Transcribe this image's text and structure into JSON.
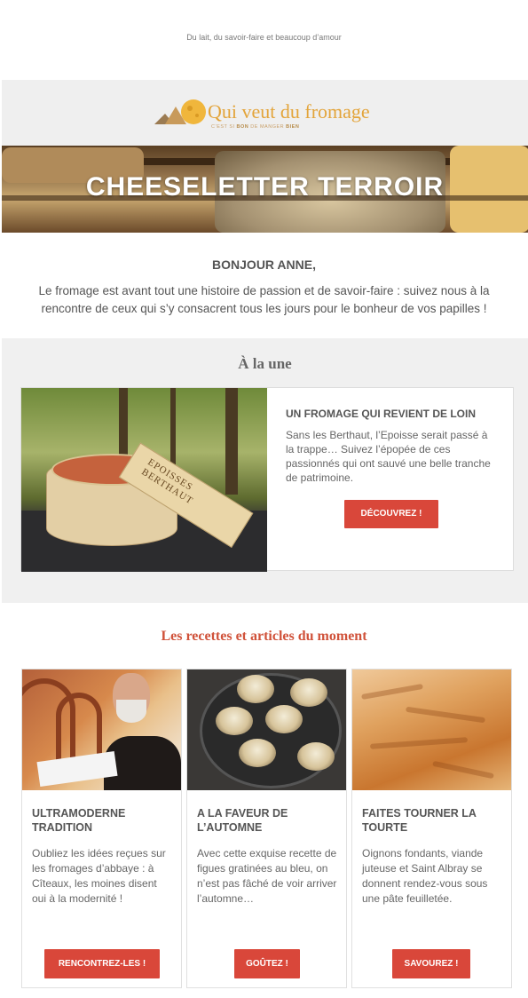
{
  "preheader": "Du lait, du savoir-faire et beaucoup d’amour",
  "logo": {
    "title": "Qui veut du fromage",
    "tagline_1": "C’EST SI ",
    "tagline_2": "BON",
    "tagline_3": " DE MANGER ",
    "tagline_4": "BIEN"
  },
  "hero": {
    "title": "CHEESELETTER TERROIR"
  },
  "greeting": "BONJOUR ANNE,",
  "intro": "Le fromage est avant tout une histoire de passion et de savoir-faire : suivez nous à la rencontre de ceux qui s’y consacrent tous les jours pour le bonheur de vos papilles !",
  "une": {
    "section_title": "À la une",
    "box_text_1": "EPOISSES",
    "box_text_2": "BERTHAUT",
    "heading": "UN FROMAGE QUI REVIENT DE LOIN",
    "text": "Sans les Berthaut, l’Epoisse serait passé à la trappe… Suivez l’épopée de ces passionnés qui ont sauvé une belle tranche de patrimoine.",
    "button": "DÉCOUVREZ !"
  },
  "recettes": {
    "section_title": "Les recettes et articles du moment",
    "cards": [
      {
        "heading": "ULTRAMODERNE TRADITION",
        "text": "Oubliez les idées reçues sur les fromages d’abbaye : à Cîteaux, les moines disent oui à la modernité !",
        "button": "RENCONTREZ-LES !"
      },
      {
        "heading": "A LA FAVEUR DE L’AUTOMNE",
        "text": "Avec cette exquise recette de figues gratinées au bleu, on n’est pas fâché de voir arriver l’automne…",
        "button": "GOÛTEZ !"
      },
      {
        "heading": "FAITES TOURNER LA TOURTE",
        "text": "Oignons fondants, viande juteuse et Saint Albray se donnent rendez-vous sous une pâte feuilletée.",
        "button": "SAVOUREZ !"
      }
    ]
  },
  "colors": {
    "accent_button": "#d9473a",
    "section_title_red": "#d0523a",
    "logo_orange": "#e3a43a",
    "band_grey": "#f0f0f0"
  }
}
